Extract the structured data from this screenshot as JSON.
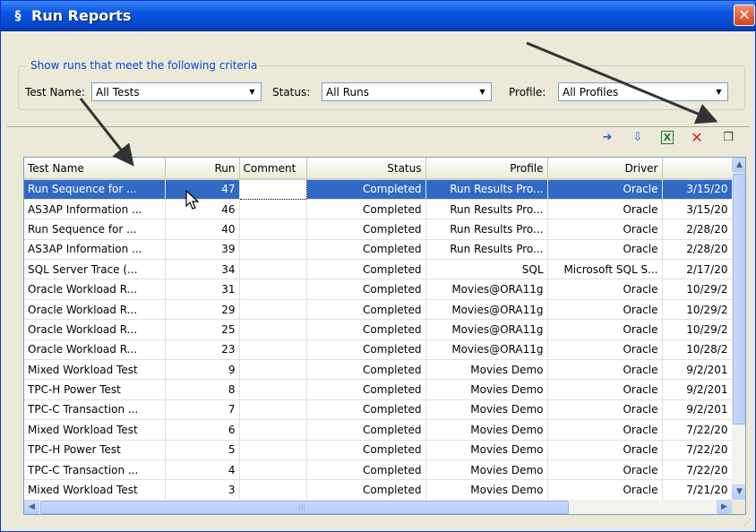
{
  "window": {
    "title": "Run Reports",
    "close_glyph": "✕",
    "icon_glyph": "§"
  },
  "criteria": {
    "legend": "Show runs that meet the following criteria",
    "test_name": {
      "label": "Test Name:",
      "value": "All Tests"
    },
    "status": {
      "label": "Status:",
      "value": "All Runs"
    },
    "profile": {
      "label": "Profile:",
      "value": "All Profiles"
    }
  },
  "toolbar": {
    "buttons": [
      {
        "name": "export-icon",
        "glyph": "➜",
        "color": "#2a60c8"
      },
      {
        "name": "import-icon",
        "glyph": "⇩",
        "color": "#2a60c8"
      },
      {
        "name": "excel-icon",
        "glyph": "X",
        "color": "#1e7a2e"
      },
      {
        "name": "delete-icon",
        "glyph": "✕",
        "color": "#d4231a"
      },
      {
        "name": "properties-icon",
        "glyph": "❐",
        "color": "#404040"
      }
    ]
  },
  "table": {
    "columns": [
      "Test Name",
      "Run",
      "Comment",
      "Status",
      "Profile",
      "Driver",
      ""
    ],
    "rows": [
      [
        "Run Sequence for ...",
        "47",
        "",
        "Completed",
        "Run Results Pro...",
        "Oracle",
        "3/15/20"
      ],
      [
        "AS3AP Information ...",
        "46",
        "",
        "Completed",
        "Run Results Pro...",
        "Oracle",
        "3/15/20"
      ],
      [
        "Run Sequence for ...",
        "40",
        "",
        "Completed",
        "Run Results Pro...",
        "Oracle",
        "2/28/20"
      ],
      [
        "AS3AP Information ...",
        "39",
        "",
        "Completed",
        "Run Results Pro...",
        "Oracle",
        "2/28/20"
      ],
      [
        "SQL Server Trace (...",
        "34",
        "",
        "Completed",
        "SQL",
        "Microsoft SQL S...",
        "2/17/20"
      ],
      [
        "Oracle Workload R...",
        "31",
        "",
        "Completed",
        "Movies@ORA11g",
        "Oracle",
        "10/29/2"
      ],
      [
        "Oracle Workload R...",
        "29",
        "",
        "Completed",
        "Movies@ORA11g",
        "Oracle",
        "10/29/2"
      ],
      [
        "Oracle Workload R...",
        "25",
        "",
        "Completed",
        "Movies@ORA11g",
        "Oracle",
        "10/29/2"
      ],
      [
        "Oracle Workload R...",
        "23",
        "",
        "Completed",
        "Movies@ORA11g",
        "Oracle",
        "10/28/2"
      ],
      [
        "Mixed Workload Test",
        "9",
        "",
        "Completed",
        "Movies Demo",
        "Oracle",
        "9/2/201"
      ],
      [
        "TPC-H Power Test",
        "8",
        "",
        "Completed",
        "Movies Demo",
        "Oracle",
        "9/2/201"
      ],
      [
        "TPC-C Transaction ...",
        "7",
        "",
        "Completed",
        "Movies Demo",
        "Oracle",
        "9/2/201"
      ],
      [
        "Mixed Workload Test",
        "6",
        "",
        "Completed",
        "Movies Demo",
        "Oracle",
        "7/22/20"
      ],
      [
        "TPC-H Power Test",
        "5",
        "",
        "Completed",
        "Movies Demo",
        "Oracle",
        "7/22/20"
      ],
      [
        "TPC-C Transaction ...",
        "4",
        "",
        "Completed",
        "Movies Demo",
        "Oracle",
        "7/22/20"
      ],
      [
        "Mixed Workload Test",
        "3",
        "",
        "Completed",
        "Movies Demo",
        "Oracle",
        "7/21/20"
      ]
    ],
    "selected_row": 0
  },
  "scrollbar": {
    "up": "▲",
    "down": "▼",
    "left": "◀",
    "right": "▶",
    "grip": "|||",
    "resize": "⋰"
  },
  "colors": {
    "selection": "#316ac5",
    "titlebar": "#0a55e0",
    "accent": "#0046d5"
  }
}
